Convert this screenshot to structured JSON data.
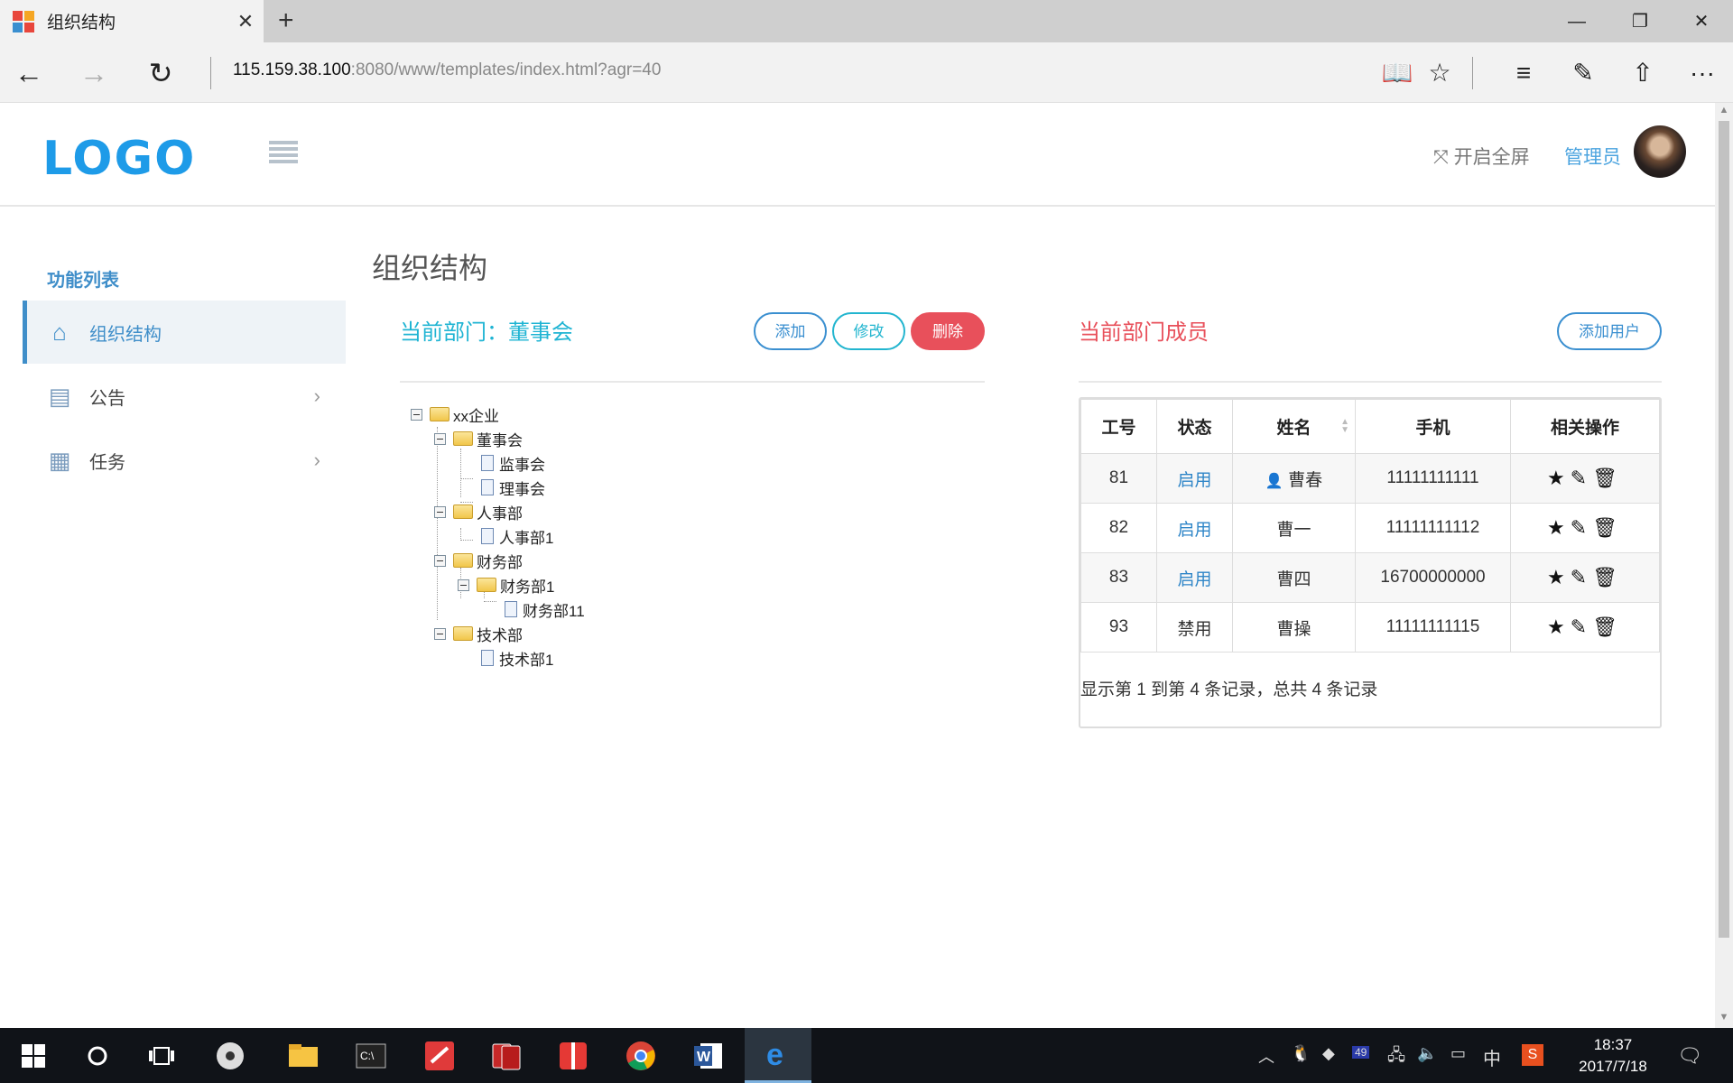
{
  "browser": {
    "tab_title": "组织结构",
    "tab_close": "✕",
    "new_tab": "+",
    "address_host": "115.159.38.100",
    "address_rest": ":8080/www/templates/index.html?agr=40",
    "win_min": "—",
    "win_restore": "❐",
    "win_close": "✕",
    "back": "←",
    "forward": "→",
    "refresh": "↻",
    "reading": "📖",
    "favorite": "☆",
    "hub": "≡",
    "note": "✎",
    "share": "⇧",
    "more": "···"
  },
  "header": {
    "logo": "LOGO",
    "fullscreen_icon": "⤧",
    "fullscreen": "开启全屏",
    "admin": "管理员"
  },
  "sidebar": {
    "title": "功能列表",
    "items": [
      {
        "label": "组织结构",
        "icon": "⌂"
      },
      {
        "label": "公告",
        "icon": "▤",
        "chev": "›"
      },
      {
        "label": "任务",
        "icon": "▦",
        "chev": "›"
      }
    ]
  },
  "main": {
    "page_title": "组织结构",
    "current_dept": "当前部门：董事会",
    "btn_add": "添加",
    "btn_edit": "修改",
    "btn_delete": "删除",
    "members_title": "当前部门成员",
    "btn_add_user": "添加用户"
  },
  "tree": {
    "nodes": [
      "xx企业",
      "董事会",
      "监事会",
      "理事会",
      "人事部",
      "人事部1",
      "财务部",
      "财务部1",
      "财务部11",
      "技术部",
      "技术部1"
    ]
  },
  "table": {
    "headers": [
      "工号",
      "状态",
      "姓名",
      "手机",
      "相关操作"
    ],
    "rows": [
      {
        "id": "81",
        "status": "启用",
        "name": "曹春",
        "phone": "11111111111",
        "ops": "★✎🗑"
      },
      {
        "id": "82",
        "status": "启用",
        "name": "曹一",
        "phone": "11111111112",
        "ops": "★✎🗑"
      },
      {
        "id": "83",
        "status": "启用",
        "name": "曹四",
        "phone": "16700000000",
        "ops": "★✎🗑"
      },
      {
        "id": "93",
        "status": "禁用",
        "name": "曹操",
        "phone": "11111111115",
        "ops": "★✎🗑"
      }
    ],
    "summary": "显示第 1 到第 4 条记录，总共 4 条记录",
    "user_icon": "👤"
  },
  "taskbar": {
    "time": "18:37",
    "date": "2017/7/18",
    "ime": "中",
    "badge": "49"
  }
}
